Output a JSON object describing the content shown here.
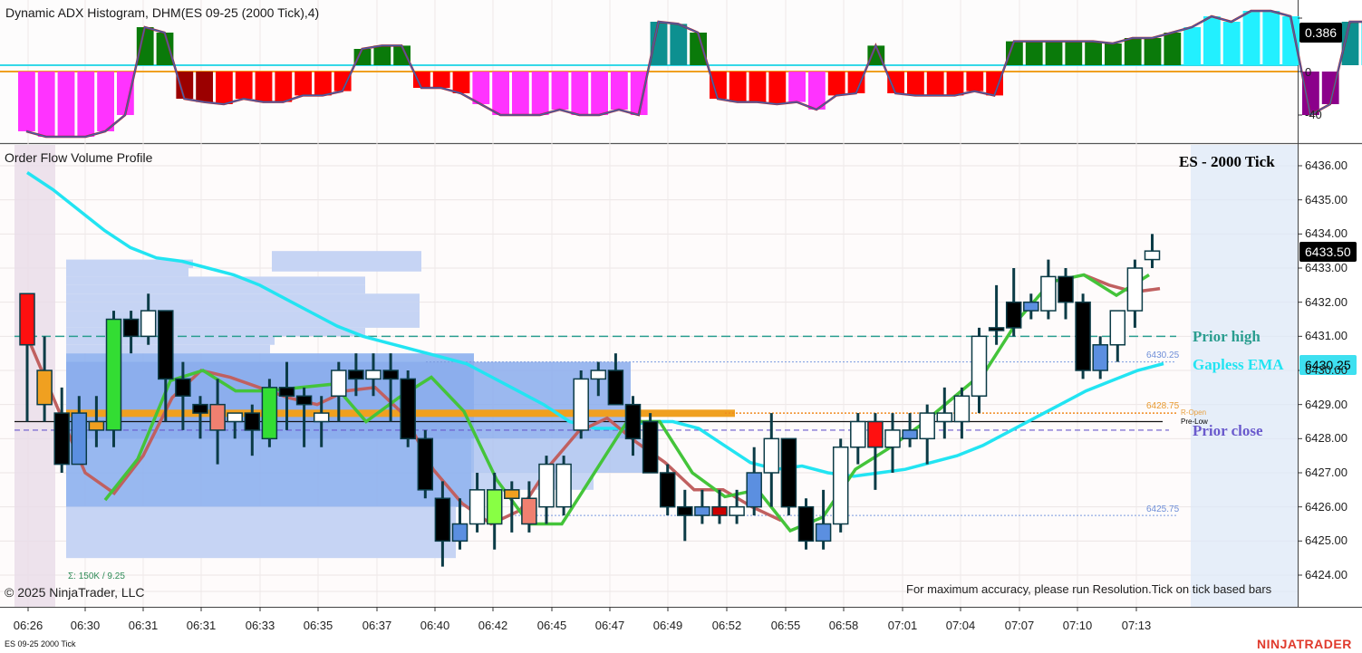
{
  "indicator_panel": {
    "title": "Dynamic ADX Histogram, DHM(ES 09-25 (2000 Tick),4)",
    "value_badge": "0.386",
    "axis_labels": [
      "0",
      "-40"
    ]
  },
  "price_panel": {
    "title": "Order Flow Volume Profile",
    "chart_name": "ES - 2000 Tick",
    "price_badge": "6433.50",
    "ema_badge": "6430.25",
    "price_axis": [
      "6436.00",
      "6435.00",
      "6434.00",
      "6433.00",
      "6432.00",
      "6431.00",
      "6430.00",
      "6429.00",
      "6428.00",
      "6427.00",
      "6426.00",
      "6425.00",
      "6424.00"
    ],
    "levels": {
      "prior_high": "Prior high",
      "gapless_ema": "Gapless EMA",
      "prior_close": "Prior close",
      "level_6430": "6430.25",
      "level_6428": "6428.75",
      "r_open": "R-Open",
      "pre_low": "Pre-Low",
      "level_6425": "6425.75"
    },
    "volume_sum": "Σ: 150K / 9.25",
    "copyright": "© 2025 NinjaTrader, LLC",
    "notice": "For maximum accuracy, please run Resolution.Tick on tick based bars"
  },
  "time_axis": [
    "06:26",
    "06:30",
    "06:31",
    "06:31",
    "06:33",
    "06:35",
    "06:37",
    "06:40",
    "06:42",
    "06:45",
    "06:47",
    "06:49",
    "06:52",
    "06:55",
    "06:58",
    "07:01",
    "07:04",
    "07:07",
    "07:10",
    "07:13"
  ],
  "footer": {
    "instrument": "ES 09-25 2000 Tick",
    "brand": "NINJATRADER"
  },
  "colors": {
    "bull_candle": "#ffffff",
    "bear_candle": "#000000",
    "wick": "#0b3b46",
    "ema_cyan": "#22e4f2",
    "ema_green": "#44c43a",
    "ema_red": "#c06060",
    "prior_high": "#2a9d8f",
    "prior_close": "#6a5acd",
    "brand": "#e03a2c"
  },
  "chart_data": {
    "type": "candlestick",
    "ylim": [
      6423.6,
      6436.4
    ],
    "bars": [
      {
        "o": 6432.25,
        "h": 6432.25,
        "l": 6428.5,
        "c": 6430.75,
        "col": "red"
      },
      {
        "o": 6430.0,
        "h": 6431.0,
        "l": 6428.5,
        "c": 6429.0,
        "col": "orange"
      },
      {
        "o": 6428.75,
        "h": 6429.5,
        "l": 6427.0,
        "c": 6427.25,
        "col": "black"
      },
      {
        "o": 6427.25,
        "h": 6429.25,
        "l": 6427.25,
        "c": 6428.75,
        "col": "blue"
      },
      {
        "o": 6428.25,
        "h": 6429.25,
        "l": 6427.75,
        "c": 6428.5,
        "col": "orange"
      },
      {
        "o": 6428.25,
        "h": 6431.75,
        "l": 6427.75,
        "c": 6431.5,
        "col": "green"
      },
      {
        "o": 6431.5,
        "h": 6431.75,
        "l": 6430.5,
        "c": 6431.0,
        "col": "black"
      },
      {
        "o": 6431.0,
        "h": 6432.25,
        "l": 6430.75,
        "c": 6431.75,
        "col": "white"
      },
      {
        "o": 6431.75,
        "h": 6431.75,
        "l": 6428.5,
        "c": 6429.75,
        "col": "black"
      },
      {
        "o": 6429.75,
        "h": 6430.25,
        "l": 6428.25,
        "c": 6429.25,
        "col": "black"
      },
      {
        "o": 6428.75,
        "h": 6429.25,
        "l": 6428.0,
        "c": 6429.0,
        "col": "black"
      },
      {
        "o": 6428.25,
        "h": 6429.75,
        "l": 6427.25,
        "c": 6429.0,
        "col": "salmon"
      },
      {
        "o": 6428.5,
        "h": 6428.75,
        "l": 6428.0,
        "c": 6428.75,
        "col": "white"
      },
      {
        "o": 6428.75,
        "h": 6429.0,
        "l": 6427.5,
        "c": 6428.25,
        "col": "black"
      },
      {
        "o": 6428.0,
        "h": 6429.75,
        "l": 6427.75,
        "c": 6429.5,
        "col": "green"
      },
      {
        "o": 6429.5,
        "h": 6430.25,
        "l": 6428.25,
        "c": 6429.25,
        "col": "black"
      },
      {
        "o": 6429.25,
        "h": 6429.5,
        "l": 6427.75,
        "c": 6429.0,
        "col": "black"
      },
      {
        "o": 6428.75,
        "h": 6429.25,
        "l": 6427.75,
        "c": 6428.5,
        "col": "white"
      },
      {
        "o": 6429.25,
        "h": 6430.25,
        "l": 6428.5,
        "c": 6430.0,
        "col": "white"
      },
      {
        "o": 6430.0,
        "h": 6430.5,
        "l": 6429.25,
        "c": 6429.75,
        "col": "black"
      },
      {
        "o": 6429.75,
        "h": 6430.5,
        "l": 6429.25,
        "c": 6430.0,
        "col": "white"
      },
      {
        "o": 6430.0,
        "h": 6430.5,
        "l": 6428.5,
        "c": 6429.75,
        "col": "black"
      },
      {
        "o": 6429.75,
        "h": 6430.0,
        "l": 6427.75,
        "c": 6428.0,
        "col": "black"
      },
      {
        "o": 6428.0,
        "h": 6428.25,
        "l": 6426.25,
        "c": 6426.5,
        "col": "black"
      },
      {
        "o": 6426.25,
        "h": 6426.75,
        "l": 6424.25,
        "c": 6425.0,
        "col": "black"
      },
      {
        "o": 6425.0,
        "h": 6426.25,
        "l": 6424.75,
        "c": 6425.5,
        "col": "blue"
      },
      {
        "o": 6425.5,
        "h": 6427.0,
        "l": 6425.25,
        "c": 6426.5,
        "col": "white"
      },
      {
        "o": 6425.5,
        "h": 6427.0,
        "l": 6424.75,
        "c": 6426.5,
        "col": "lime"
      },
      {
        "o": 6426.25,
        "h": 6426.75,
        "l": 6425.25,
        "c": 6426.5,
        "col": "orange"
      },
      {
        "o": 6425.5,
        "h": 6426.75,
        "l": 6425.25,
        "c": 6426.25,
        "col": "salmon"
      },
      {
        "o": 6426.0,
        "h": 6427.5,
        "l": 6425.5,
        "c": 6427.25,
        "col": "white"
      },
      {
        "o": 6426.0,
        "h": 6427.5,
        "l": 6425.75,
        "c": 6427.25,
        "col": "white"
      },
      {
        "o": 6428.25,
        "h": 6430.0,
        "l": 6428.0,
        "c": 6429.75,
        "col": "white"
      },
      {
        "o": 6429.75,
        "h": 6430.25,
        "l": 6429.25,
        "c": 6430.0,
        "col": "white"
      },
      {
        "o": 6430.0,
        "h": 6430.5,
        "l": 6429.0,
        "c": 6429.0,
        "col": "black"
      },
      {
        "o": 6429.0,
        "h": 6429.25,
        "l": 6427.5,
        "c": 6428.0,
        "col": "black"
      },
      {
        "o": 6428.5,
        "h": 6428.75,
        "l": 6427.0,
        "c": 6427.0,
        "col": "black"
      },
      {
        "o": 6427.0,
        "h": 6427.25,
        "l": 6425.75,
        "c": 6426.0,
        "col": "black"
      },
      {
        "o": 6426.0,
        "h": 6426.5,
        "l": 6425.0,
        "c": 6425.75,
        "col": "black"
      },
      {
        "o": 6425.75,
        "h": 6426.5,
        "l": 6425.5,
        "c": 6426.0,
        "col": "blue"
      },
      {
        "o": 6425.75,
        "h": 6426.5,
        "l": 6425.5,
        "c": 6426.0,
        "col": "darkred"
      },
      {
        "o": 6425.75,
        "h": 6426.5,
        "l": 6425.5,
        "c": 6426.0,
        "col": "white"
      },
      {
        "o": 6426.0,
        "h": 6427.75,
        "l": 6425.75,
        "c": 6427.0,
        "col": "blue"
      },
      {
        "o": 6427.0,
        "h": 6428.75,
        "l": 6426.0,
        "c": 6428.0,
        "col": "white"
      },
      {
        "o": 6428.0,
        "h": 6428.0,
        "l": 6425.75,
        "c": 6426.0,
        "col": "black"
      },
      {
        "o": 6426.0,
        "h": 6426.25,
        "l": 6424.75,
        "c": 6425.0,
        "col": "black"
      },
      {
        "o": 6425.0,
        "h": 6426.5,
        "l": 6424.75,
        "c": 6425.5,
        "col": "blue"
      },
      {
        "o": 6425.5,
        "h": 6428.0,
        "l": 6425.25,
        "c": 6427.75,
        "col": "white"
      },
      {
        "o": 6427.75,
        "h": 6428.75,
        "l": 6427.25,
        "c": 6428.5,
        "col": "white"
      },
      {
        "o": 6428.5,
        "h": 6428.75,
        "l": 6426.5,
        "c": 6427.75,
        "col": "red"
      },
      {
        "o": 6427.75,
        "h": 6428.75,
        "l": 6427.0,
        "c": 6428.25,
        "col": "white"
      },
      {
        "o": 6428.25,
        "h": 6428.75,
        "l": 6427.75,
        "c": 6428.0,
        "col": "blue"
      },
      {
        "o": 6428.0,
        "h": 6429.0,
        "l": 6427.25,
        "c": 6428.75,
        "col": "white"
      },
      {
        "o": 6428.75,
        "h": 6429.5,
        "l": 6428.0,
        "c": 6428.5,
        "col": "white"
      },
      {
        "o": 6428.5,
        "h": 6429.5,
        "l": 6428.0,
        "c": 6429.25,
        "col": "white"
      },
      {
        "o": 6429.25,
        "h": 6431.25,
        "l": 6428.75,
        "c": 6431.0,
        "col": "white"
      },
      {
        "o": 6431.25,
        "h": 6432.5,
        "l": 6430.75,
        "c": 6431.25,
        "col": "black"
      },
      {
        "o": 6431.25,
        "h": 6433.0,
        "l": 6431.0,
        "c": 6432.0,
        "col": "black"
      },
      {
        "o": 6432.0,
        "h": 6432.25,
        "l": 6431.5,
        "c": 6431.75,
        "col": "blue"
      },
      {
        "o": 6431.75,
        "h": 6433.25,
        "l": 6431.5,
        "c": 6432.75,
        "col": "white"
      },
      {
        "o": 6432.75,
        "h": 6433.0,
        "l": 6431.5,
        "c": 6432.0,
        "col": "black"
      },
      {
        "o": 6432.0,
        "h": 6432.25,
        "l": 6429.75,
        "c": 6430.0,
        "col": "black"
      },
      {
        "o": 6430.0,
        "h": 6431.0,
        "l": 6429.75,
        "c": 6430.75,
        "col": "blue"
      },
      {
        "o": 6430.75,
        "h": 6431.75,
        "l": 6430.25,
        "c": 6431.75,
        "col": "white"
      },
      {
        "o": 6431.75,
        "h": 6433.25,
        "l": 6431.25,
        "c": 6433.0,
        "col": "white"
      },
      {
        "o": 6433.25,
        "h": 6434.0,
        "l": 6433.0,
        "c": 6433.5,
        "col": "white"
      }
    ],
    "histogram": [
      -55,
      -60,
      -60,
      -60,
      -55,
      -40,
      35,
      30,
      -25,
      -28,
      -30,
      -25,
      -28,
      -28,
      -22,
      -22,
      -18,
      15,
      18,
      18,
      -15,
      -15,
      -20,
      -30,
      -40,
      -40,
      -40,
      -35,
      -40,
      -40,
      -35,
      -40,
      40,
      38,
      30,
      -25,
      -28,
      -28,
      -30,
      -28,
      -35,
      -22,
      -20,
      18,
      -20,
      -22,
      -22,
      -22,
      -18,
      -22,
      22,
      22,
      22,
      22,
      22,
      20,
      25,
      25,
      30,
      35,
      45,
      40,
      50,
      50,
      45,
      -40,
      -30,
      40,
      40,
      45,
      45
    ],
    "hist_colors": [
      "magenta",
      "magenta",
      "magenta",
      "magenta",
      "magenta",
      "magenta",
      "green",
      "green",
      "darkred",
      "darkred",
      "red",
      "red",
      "red",
      "red",
      "red",
      "red",
      "red",
      "green",
      "green",
      "green",
      "red",
      "red",
      "red",
      "magenta",
      "magenta",
      "magenta",
      "magenta",
      "magenta",
      "magenta",
      "magenta",
      "magenta",
      "magenta",
      "teal",
      "teal",
      "green",
      "red",
      "red",
      "red",
      "red",
      "magenta",
      "magenta",
      "red",
      "red",
      "green",
      "red",
      "red",
      "red",
      "red",
      "red",
      "red",
      "green",
      "green",
      "green",
      "green",
      "green",
      "green",
      "green",
      "green",
      "green",
      "cyan",
      "cyan",
      "cyan",
      "cyan",
      "cyan",
      "cyan",
      "purple",
      "purple",
      "teal",
      "cyan",
      "cyan",
      "cyan"
    ],
    "ema_cyan": [
      6435.8,
      6435.3,
      6434.7,
      6434.1,
      6433.6,
      6433.3,
      6433.2,
      6433.0,
      6432.8,
      6432.5,
      6432.1,
      6431.7,
      6431.3,
      6431.0,
      6430.8,
      6430.6,
      6430.4,
      6430.2,
      6429.8,
      6429.4,
      6429.0,
      6428.5,
      6428.3,
      6428.3,
      6428.5,
      6428.5,
      6428.3,
      6427.8,
      6427.3,
      6427.1,
      6427.2,
      6427.0,
      6426.9,
      6427.0,
      6427.1,
      6427.3,
      6427.5,
      6427.8,
      6428.2,
      6428.6,
      6429.0,
      6429.4,
      6429.7,
      6430.0,
      6430.2
    ],
    "ema_green": [
      6426.2,
      6427.4,
      6429.7,
      6430.0,
      6429.4,
      6429.4,
      6429.5,
      6429.6,
      6428.5,
      6429.2,
      6429.8,
      6428.8,
      6426.8,
      6425.5,
      6425.5,
      6427.0,
      6428.5,
      6428.5,
      6427.0,
      6426.3,
      6426.5,
      6425.3,
      6425.7,
      6427.1,
      6427.7,
      6428.4,
      6429.2,
      6430.0,
      6431.5,
      6432.6,
      6432.8,
      6432.2,
      6432.8
    ],
    "ema_red": [
      6431.0,
      6429.0,
      6427.0,
      6426.4,
      6427.5,
      6429.2,
      6430.0,
      6429.8,
      6429.5,
      6429.2,
      6429.0,
      6429.4,
      6429.5,
      6428.7,
      6427.1,
      6426.1,
      6425.5,
      6425.9,
      6427.2,
      6428.2,
      6428.6,
      6427.9,
      6427.3,
      6426.5,
      6426.5,
      6426.0,
      6425.6,
      6432.8,
      6432.5,
      6432.3,
      6432.4
    ]
  }
}
